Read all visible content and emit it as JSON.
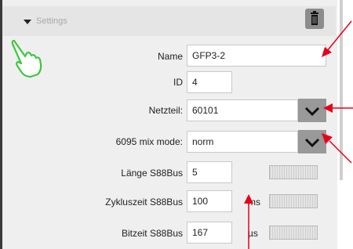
{
  "header": {
    "title": "Settings"
  },
  "fields": {
    "name": {
      "label": "Name",
      "value": "GFP3-2"
    },
    "id": {
      "label": "ID",
      "value": "4"
    },
    "netzteil": {
      "label": "Netzteil:",
      "value": "60101"
    },
    "mix_mode": {
      "label": "6095 mix mode:",
      "value": "norm"
    },
    "laenge": {
      "label": "Länge S88Bus",
      "value": "5"
    },
    "zykluszeit": {
      "label": "Zykluszeit S88Bus",
      "value": "100",
      "unit": "ms"
    },
    "bitzeit": {
      "label": "Bitzeit S88Bus",
      "value": "167",
      "unit": "µs"
    }
  },
  "icons": {
    "trash": "trash-icon",
    "dropdown": "chevron-down-icon",
    "pointer": "hand-pointer-icon"
  },
  "colors": {
    "panel": "#efefef",
    "dropdown_button": "#999999",
    "annotation_arrow": "#e8001c",
    "hand_outline": "#3cc83c"
  }
}
